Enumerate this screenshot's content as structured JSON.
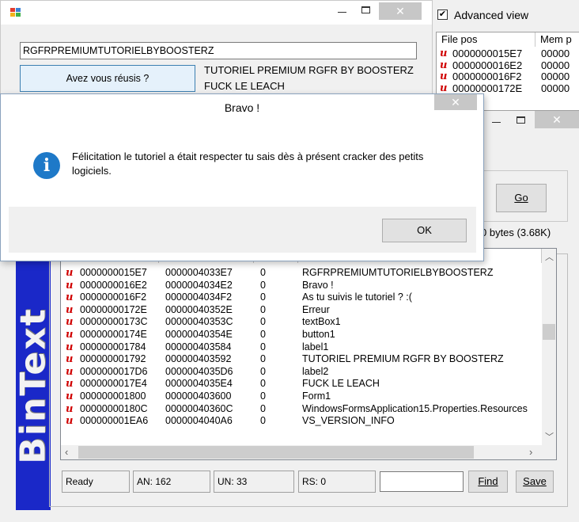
{
  "left_window": {
    "text_input_value": "RGFRPREMIUMTUTORIELBYBOOSTERZ",
    "button_label": "Avez vous réusis ?",
    "label1": "TUTORIEL PREMIUM RGFR BY BOOSTERZ",
    "label2": "FUCK LE LEACH",
    "close_glyph": "✕"
  },
  "right_panel": {
    "advanced_view_label": "Advanced view",
    "advanced_view_checked": true,
    "col_file_pos": "File pos",
    "col_mem_pos": "Mem p",
    "mini_rows": [
      {
        "file": "0000000015E7",
        "mem": "00000"
      },
      {
        "file": "0000000016E2",
        "mem": "00000"
      },
      {
        "file": "0000000016F2",
        "mem": "00000"
      },
      {
        "file": "00000000172E",
        "mem": "00000"
      }
    ]
  },
  "bintext": {
    "brand": "BinText",
    "go_label": "Go",
    "size_label": "0 bytes (3.68K)",
    "close_glyph": "✕",
    "rows": [
      {
        "file": "0000000015E7",
        "mem": "0000004033E7",
        "id": "0",
        "text": "RGFRPREMIUMTUTORIELBYBOOSTERZ"
      },
      {
        "file": "0000000016E2",
        "mem": "0000004034E2",
        "id": "0",
        "text": "Bravo !"
      },
      {
        "file": "0000000016F2",
        "mem": "0000004034F2",
        "id": "0",
        "text": "As tu suivis le tutoriel ? :("
      },
      {
        "file": "00000000172E",
        "mem": "00000040352E",
        "id": "0",
        "text": "Erreur"
      },
      {
        "file": "00000000173C",
        "mem": "00000040353C",
        "id": "0",
        "text": "textBox1"
      },
      {
        "file": "00000000174E",
        "mem": "00000040354E",
        "id": "0",
        "text": "button1"
      },
      {
        "file": "000000001784",
        "mem": "000000403584",
        "id": "0",
        "text": "label1"
      },
      {
        "file": "000000001792",
        "mem": "000000403592",
        "id": "0",
        "text": "TUTORIEL PREMIUM RGFR BY BOOSTERZ"
      },
      {
        "file": "0000000017D6",
        "mem": "0000004035D6",
        "id": "0",
        "text": "label2"
      },
      {
        "file": "0000000017E4",
        "mem": "0000004035E4",
        "id": "0",
        "text": "FUCK LE LEACH"
      },
      {
        "file": "000000001800",
        "mem": "000000403600",
        "id": "0",
        "text": "Form1"
      },
      {
        "file": "00000000180C",
        "mem": "00000040360C",
        "id": "0",
        "text": "WindowsFormsApplication15.Properties.Resources"
      },
      {
        "file": "000000001EA6",
        "mem": "0000004040A6",
        "id": "0",
        "text": "VS_VERSION_INFO"
      }
    ],
    "status": {
      "ready": "Ready",
      "an": "AN: 162",
      "un": "UN: 33",
      "rs": "RS: 0",
      "find_value": "",
      "find_label": "Find",
      "save_label": "Save"
    }
  },
  "dialog": {
    "title": "Bravo !",
    "message": "Félicitation le tutoriel a était respecter tu sais dès à présent cracker des petits logiciels.",
    "ok_label": "OK",
    "close_glyph": "✕",
    "info_glyph": "i"
  },
  "colors": {
    "accent_blue": "#1e79c8",
    "bintext_blue": "#1a28c8",
    "error_red": "#d00000",
    "close_gray": "#c7c7c7"
  }
}
